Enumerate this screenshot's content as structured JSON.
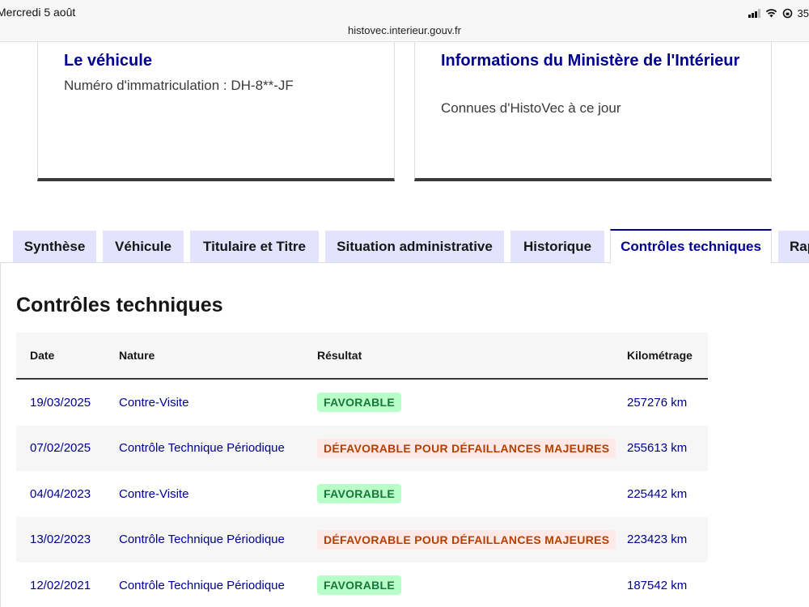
{
  "status_bar": {
    "date": "Mercredi 5 août",
    "url": "histovec.interieur.gouv.fr",
    "battery": "35"
  },
  "cards": {
    "vehicle": {
      "title": "Le véhicule",
      "text": "Numéro d'immatriculation : DH-8**-JF"
    },
    "ministry": {
      "title": "Informations du Ministère de l'Intérieur",
      "text": "Connues d'HistoVec à ce jour"
    }
  },
  "tabs": [
    {
      "label": "Synthèse"
    },
    {
      "label": "Véhicule"
    },
    {
      "label": "Titulaire et Titre"
    },
    {
      "label": "Situation administrative"
    },
    {
      "label": "Historique"
    },
    {
      "label": "Contrôles techniques"
    },
    {
      "label": "Rap"
    }
  ],
  "active_tab": "Contrôles techniques",
  "panel": {
    "title": "Contrôles techniques",
    "table": {
      "headers": {
        "date": "Date",
        "nature": "Nature",
        "result": "Résultat",
        "km": "Kilométrage"
      },
      "rows": [
        {
          "date": "19/03/2025",
          "nature": "Contre-Visite",
          "result": "FAVORABLE",
          "km": "257276 km"
        },
        {
          "date": "07/02/2025",
          "nature": "Contrôle Technique Périodique",
          "result": "DÉFAVORABLE POUR DÉFAILLANCES MAJEURES",
          "km": "255613 km"
        },
        {
          "date": "04/04/2023",
          "nature": "Contre-Visite",
          "result": "FAVORABLE",
          "km": "225442 km"
        },
        {
          "date": "13/02/2023",
          "nature": "Contrôle Technique Périodique",
          "result": "DÉFAVORABLE POUR DÉFAILLANCES MAJEURES",
          "km": "223423 km"
        },
        {
          "date": "12/02/2021",
          "nature": "Contrôle Technique Périodique",
          "result": "FAVORABLE",
          "km": "187542 km"
        }
      ]
    }
  },
  "colors": {
    "primary_blue": "#000091",
    "tab_bg": "#e3e3fd",
    "success_bg": "#b8fec9",
    "success_text": "#18753c",
    "error_bg": "#ffe9e6",
    "error_text": "#b34000"
  }
}
